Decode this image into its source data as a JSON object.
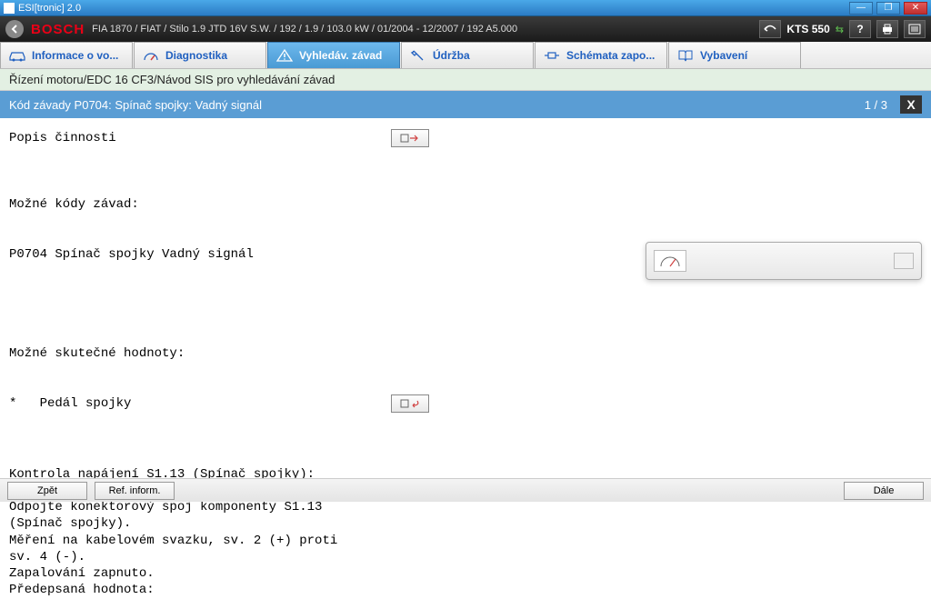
{
  "window": {
    "title": "ESI[tronic] 2.0"
  },
  "header": {
    "brand": "BOSCH",
    "vehicle": "FIA 1870 / FIAT / Stilo 1.9 JTD 16V S.W. / 192 / 1.9 / 103.0 kW / 01/2004 - 12/2007 / 192 A5.000",
    "device": "KTS 550"
  },
  "tabs": [
    {
      "label": "Informace o vo...",
      "active": false
    },
    {
      "label": "Diagnostika",
      "active": false
    },
    {
      "label": "Vyhledáv. závad",
      "active": true
    },
    {
      "label": "Údržba",
      "active": false
    },
    {
      "label": "Schémata zapo...",
      "active": false
    },
    {
      "label": "Vybavení",
      "active": false
    }
  ],
  "breadcrumb": "Řízení motoru/EDC 16 CF3/Návod SIS pro vyhledávání závad",
  "fault": {
    "title": "Kód závady P0704: Spínač spojky: Vadný signál",
    "page": "1 / 3"
  },
  "content": {
    "activity_label": "Popis činnosti",
    "possible_codes_label": "Možné kódy závad:",
    "code_line": "P0704 Spínač spojky Vadný signál",
    "actual_values_label": "Možné skutečné hodnoty:",
    "actual_value_item": "*   Pedál spojky",
    "instructions": "Kontrola napájení S1.13 (Spínač spojky):\nZapalování je vypnuto.\nOdpojte konektorový spoj komponenty S1.13\n(Spínač spojky).\nMěření na kabelovém svazku, sv. 2 (+) proti\nsv. 4 (-).\nZapalování zapnuto.\nPředepsaná hodnota:"
  },
  "footer": {
    "back": "Zpět",
    "ref": "Ref. inform.",
    "next": "Dále"
  }
}
